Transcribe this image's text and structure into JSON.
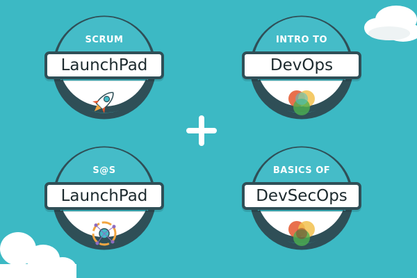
{
  "badges": [
    {
      "top": "SCRUM",
      "name": "LaunchPad",
      "icon": "rocket-icon"
    },
    {
      "top": "INTRO TO",
      "name": "DevOps",
      "icon": "overlapping-circles-icon"
    },
    {
      "top": "S@S",
      "name": "LaunchPad",
      "icon": "network-cycle-icon"
    },
    {
      "top": "BASICS OF",
      "name": "DevSecOps",
      "icon": "overlapping-circles-icon"
    }
  ],
  "connector": {
    "icon": "plus-icon"
  },
  "colors": {
    "background": "#3cb9c4",
    "badge_fill": "#45bcc8",
    "badge_border": "#2f4f57",
    "banner_text": "#1d2a2e"
  }
}
